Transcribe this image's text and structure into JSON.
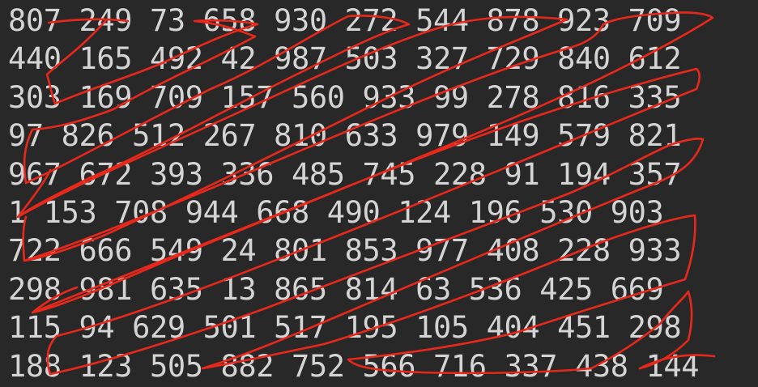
{
  "rows": [
    "807 249 73 658 930 272 544 878 923 709",
    "440 165 492 42 987 503 327 729 840 612",
    "303 169 709 157 560 933 99 278 816 335",
    "97 826 512 267 810 633 979 149 579 821",
    "967 672 393 336 485 745 228 91 194 357",
    "1 153 708 944 668 490 124 196 530 903",
    "722 666 549 24 801 853 977 408 228 933",
    "298 981 635 13 865 814 63 536 425 669",
    "115 94 629 501 517 195 105 404 451 298",
    "188 123 505 882 752 566 716 337 438 144"
  ],
  "colors": {
    "background": "#282828",
    "text": "#d4d4d4",
    "scribble": "#e8281b"
  }
}
